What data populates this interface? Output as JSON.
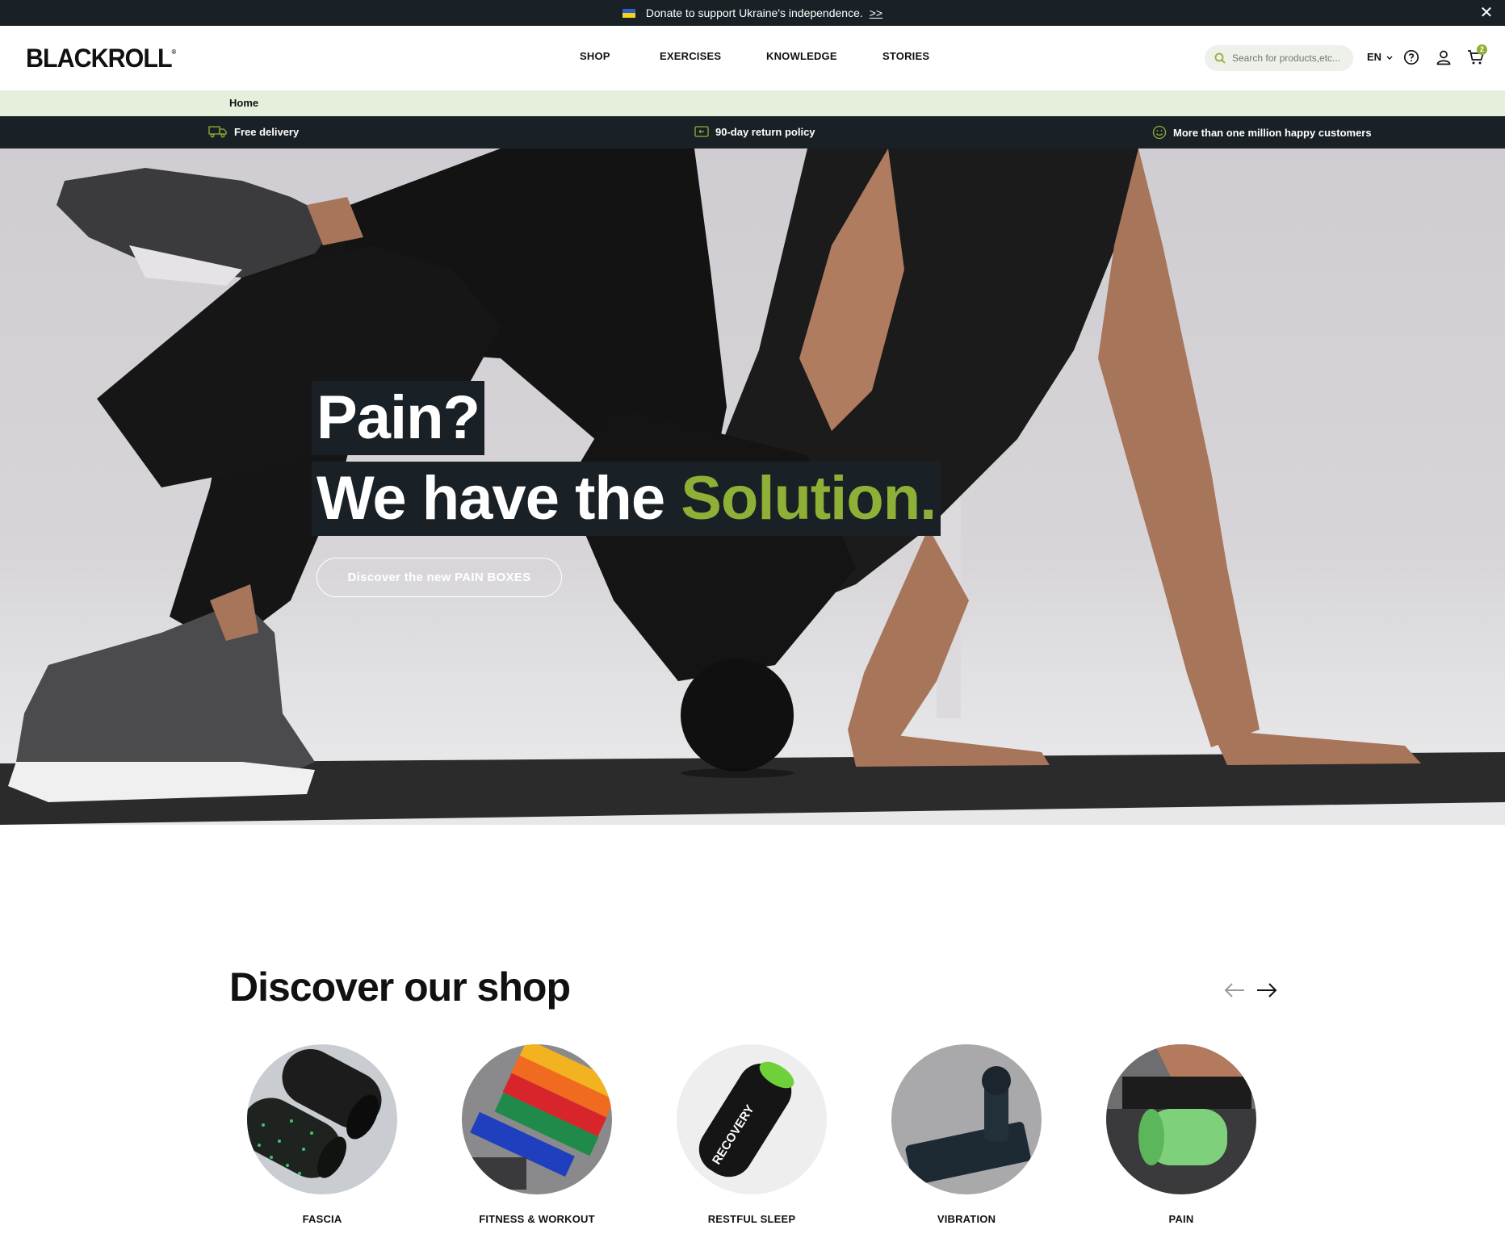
{
  "topbar": {
    "message": "Donate to support Ukraine's independence.",
    "link": ">>",
    "close": "✕"
  },
  "header": {
    "logo": "BLACKROLL",
    "nav": [
      "SHOP",
      "EXERCISES",
      "KNOWLEDGE",
      "STORIES"
    ],
    "search_placeholder": "Search for products,etc...",
    "language": "EN",
    "cart_count": "2"
  },
  "breadcrumb": {
    "home": "Home"
  },
  "usp": {
    "items": [
      "Free delivery",
      "90-day return policy",
      "More than one million happy customers"
    ]
  },
  "hero": {
    "line1": "Pain?",
    "line2_main": "We have the",
    "line2_accent": "Solution.",
    "button": "Discover the new PAIN BOXES"
  },
  "shop": {
    "title": "Discover our shop",
    "categories": [
      "FASCIA",
      "FITNESS & WORKOUT",
      "RESTFUL SLEEP",
      "VIBRATION",
      "PAIN"
    ]
  },
  "colors": {
    "dark": "#1a2126",
    "accent": "#8fb036",
    "breadcrumb_bg": "#e6efdc"
  },
  "icons": [
    "ukraine-flag-icon",
    "close-icon",
    "search-icon",
    "chevron-down-icon",
    "help-icon",
    "user-icon",
    "cart-icon",
    "truck-icon",
    "return-icon",
    "smiley-icon",
    "arrow-left-icon",
    "arrow-right-icon"
  ]
}
